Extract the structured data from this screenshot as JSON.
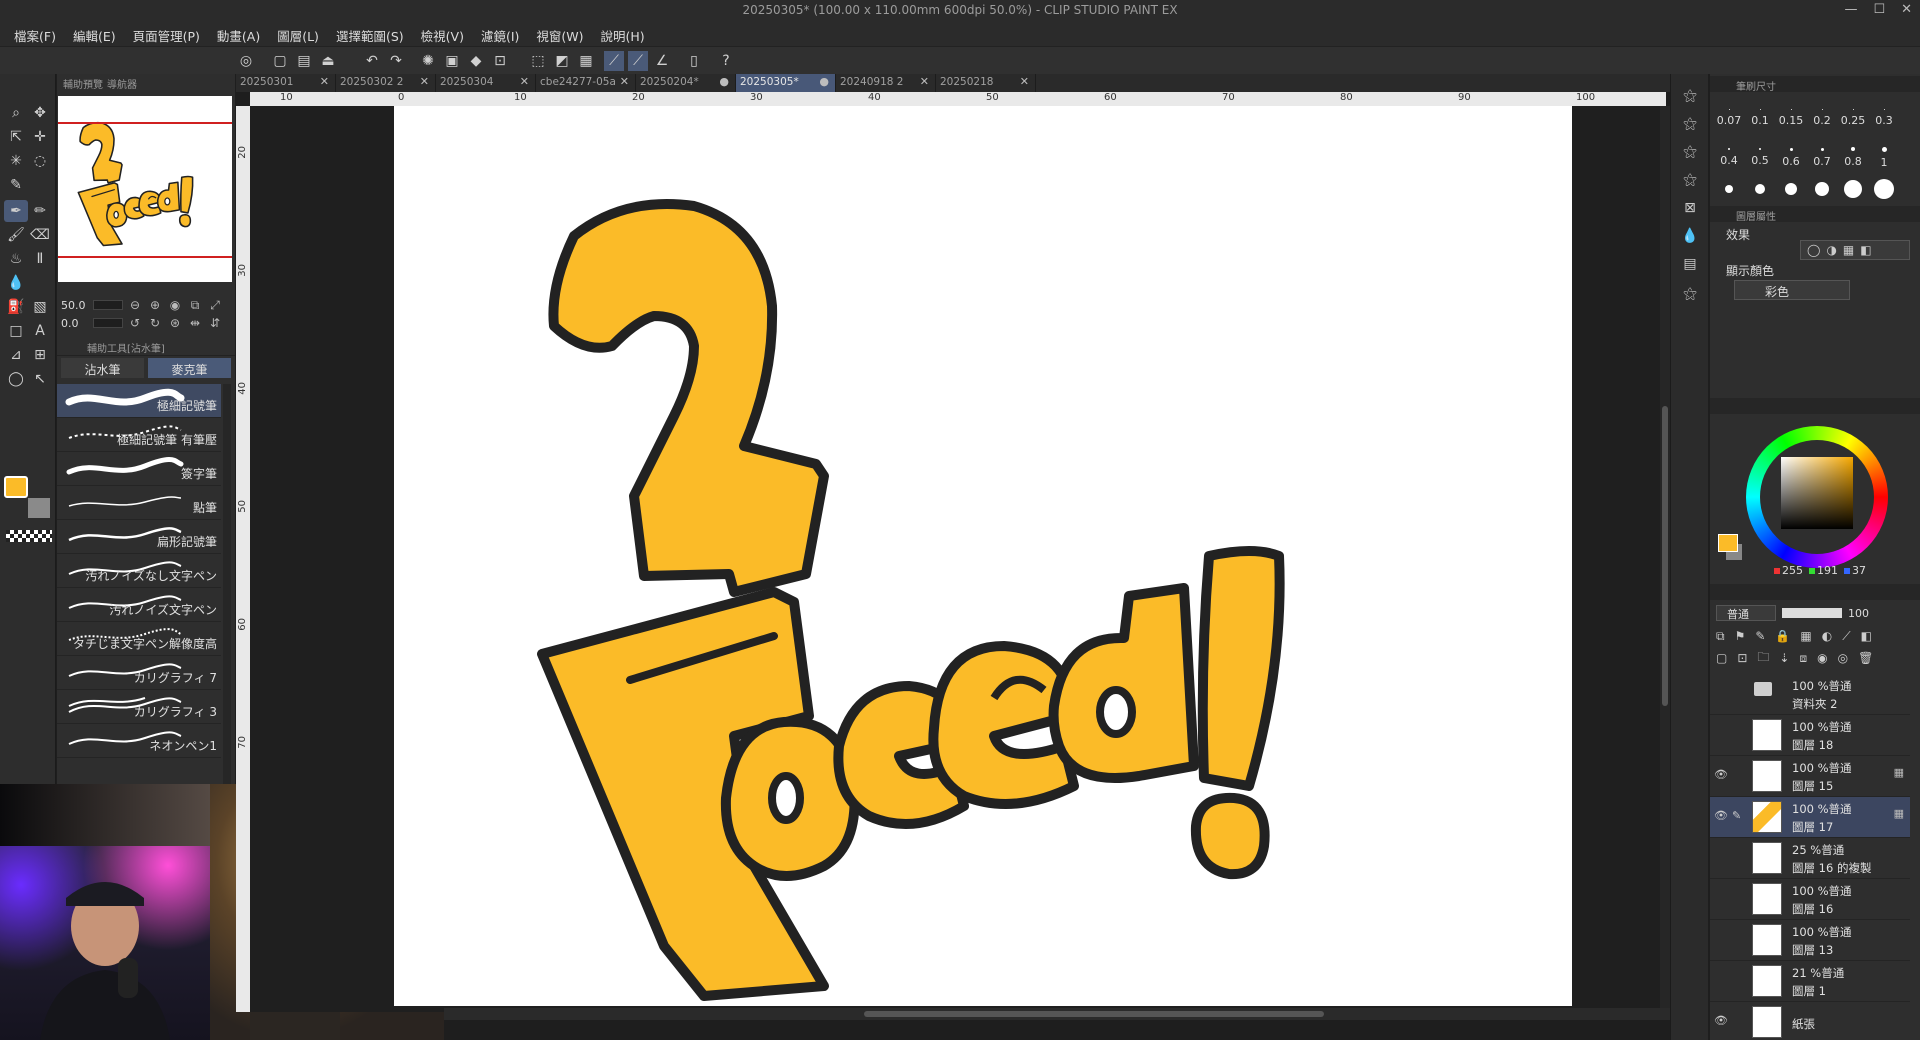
{
  "window": {
    "title": "20250305* (100.00 x 110.00mm 600dpi 50.0%)  - CLIP STUDIO PAINT EX",
    "controls": [
      "—",
      "☐",
      "✕"
    ]
  },
  "menu": [
    "檔案(F)",
    "編輯(E)",
    "頁面管理(P)",
    "動畫(A)",
    "圖層(L)",
    "選擇範圍(S)",
    "檢視(V)",
    "濾鏡(I)",
    "視窗(W)",
    "說明(H)"
  ],
  "navigator": {
    "tabs": [
      "輔助預覽",
      "導航器"
    ],
    "zoom_value": "50.0",
    "rotate_value": "0.0"
  },
  "subtool": {
    "header": "輔助工具[沾水筆]",
    "tabs": [
      "沾水筆",
      "麥克筆"
    ],
    "active_tab": 1,
    "brushes": [
      "極細記號筆",
      "極細記號筆 有筆壓",
      "簽字筆",
      "點筆",
      "扁形記號筆",
      "汚れノイズなし文字ペン",
      "汚れノイズ文字ペン",
      "タチじま文字ペン解像度高",
      "カリグラフィ 7",
      "カリグラフィ 3",
      "ネオンペン1"
    ]
  },
  "document_tabs": [
    {
      "label": "20250301",
      "active": false
    },
    {
      "label": "20250302 2",
      "active": false
    },
    {
      "label": "20250304",
      "active": false
    },
    {
      "label": "cbe24277-05a",
      "active": false
    },
    {
      "label": "20250204*",
      "active": false
    },
    {
      "label": "20250305*",
      "active": true
    },
    {
      "label": "20240918 2",
      "active": false
    },
    {
      "label": "20250218",
      "active": false
    }
  ],
  "ruler": {
    "top": [
      "10",
      "0",
      "10",
      "20",
      "30",
      "40",
      "50",
      "60",
      "70",
      "80",
      "90",
      "100"
    ],
    "left": [
      "20",
      "30",
      "40",
      "50",
      "60",
      "70"
    ]
  },
  "artwork": {
    "digit": "2",
    "word": "Faced",
    "mark": "!",
    "fill_color": "#fbbb28",
    "outline_color": "#222222"
  },
  "brush_size": {
    "sizes": [
      "0.07",
      "0.1",
      "0.15",
      "0.2",
      "0.25",
      "0.3",
      "0.4",
      "0.5",
      "0.6",
      "0.7",
      "0.8",
      "1",
      "",
      "",
      "",
      "",
      "",
      ""
    ]
  },
  "layer_property": {
    "header": "圖層屬性",
    "effect_label": "效果",
    "display_color_label": "顯示顏色",
    "display_color_value": "彩色"
  },
  "color": {
    "foreground": "#fbbb28",
    "background": "#888888",
    "r": "255",
    "g": "191",
    "b": "37"
  },
  "layer_panel": {
    "blend_mode": "普通",
    "opacity": "100",
    "layers": [
      {
        "mode": "100 %普通",
        "name": "資料夾 2",
        "type": "folder",
        "visible": false,
        "active": false,
        "flag": ""
      },
      {
        "mode": "100 %普通",
        "name": "圖層 18",
        "type": "layer",
        "visible": false,
        "active": false,
        "flag": ""
      },
      {
        "mode": "100 %普通",
        "name": "圖層 15",
        "type": "layer",
        "visible": true,
        "active": false,
        "flag": "▦"
      },
      {
        "mode": "100 %普通",
        "name": "圖層 17",
        "type": "layer",
        "visible": true,
        "active": true,
        "flag": "▦"
      },
      {
        "mode": "25 %普通",
        "name": "圖層 16 的複製",
        "type": "layer",
        "visible": false,
        "active": false,
        "flag": ""
      },
      {
        "mode": "100 %普通",
        "name": "圖層 16",
        "type": "layer",
        "visible": false,
        "active": false,
        "flag": ""
      },
      {
        "mode": "100 %普通",
        "name": "圖層 13",
        "type": "layer",
        "visible": false,
        "active": false,
        "flag": ""
      },
      {
        "mode": "21 %普通",
        "name": "圖層 1",
        "type": "layer",
        "visible": false,
        "active": false,
        "flag": ""
      },
      {
        "mode": "",
        "name": "紙張",
        "type": "paper",
        "visible": true,
        "active": false,
        "flag": ""
      }
    ]
  }
}
